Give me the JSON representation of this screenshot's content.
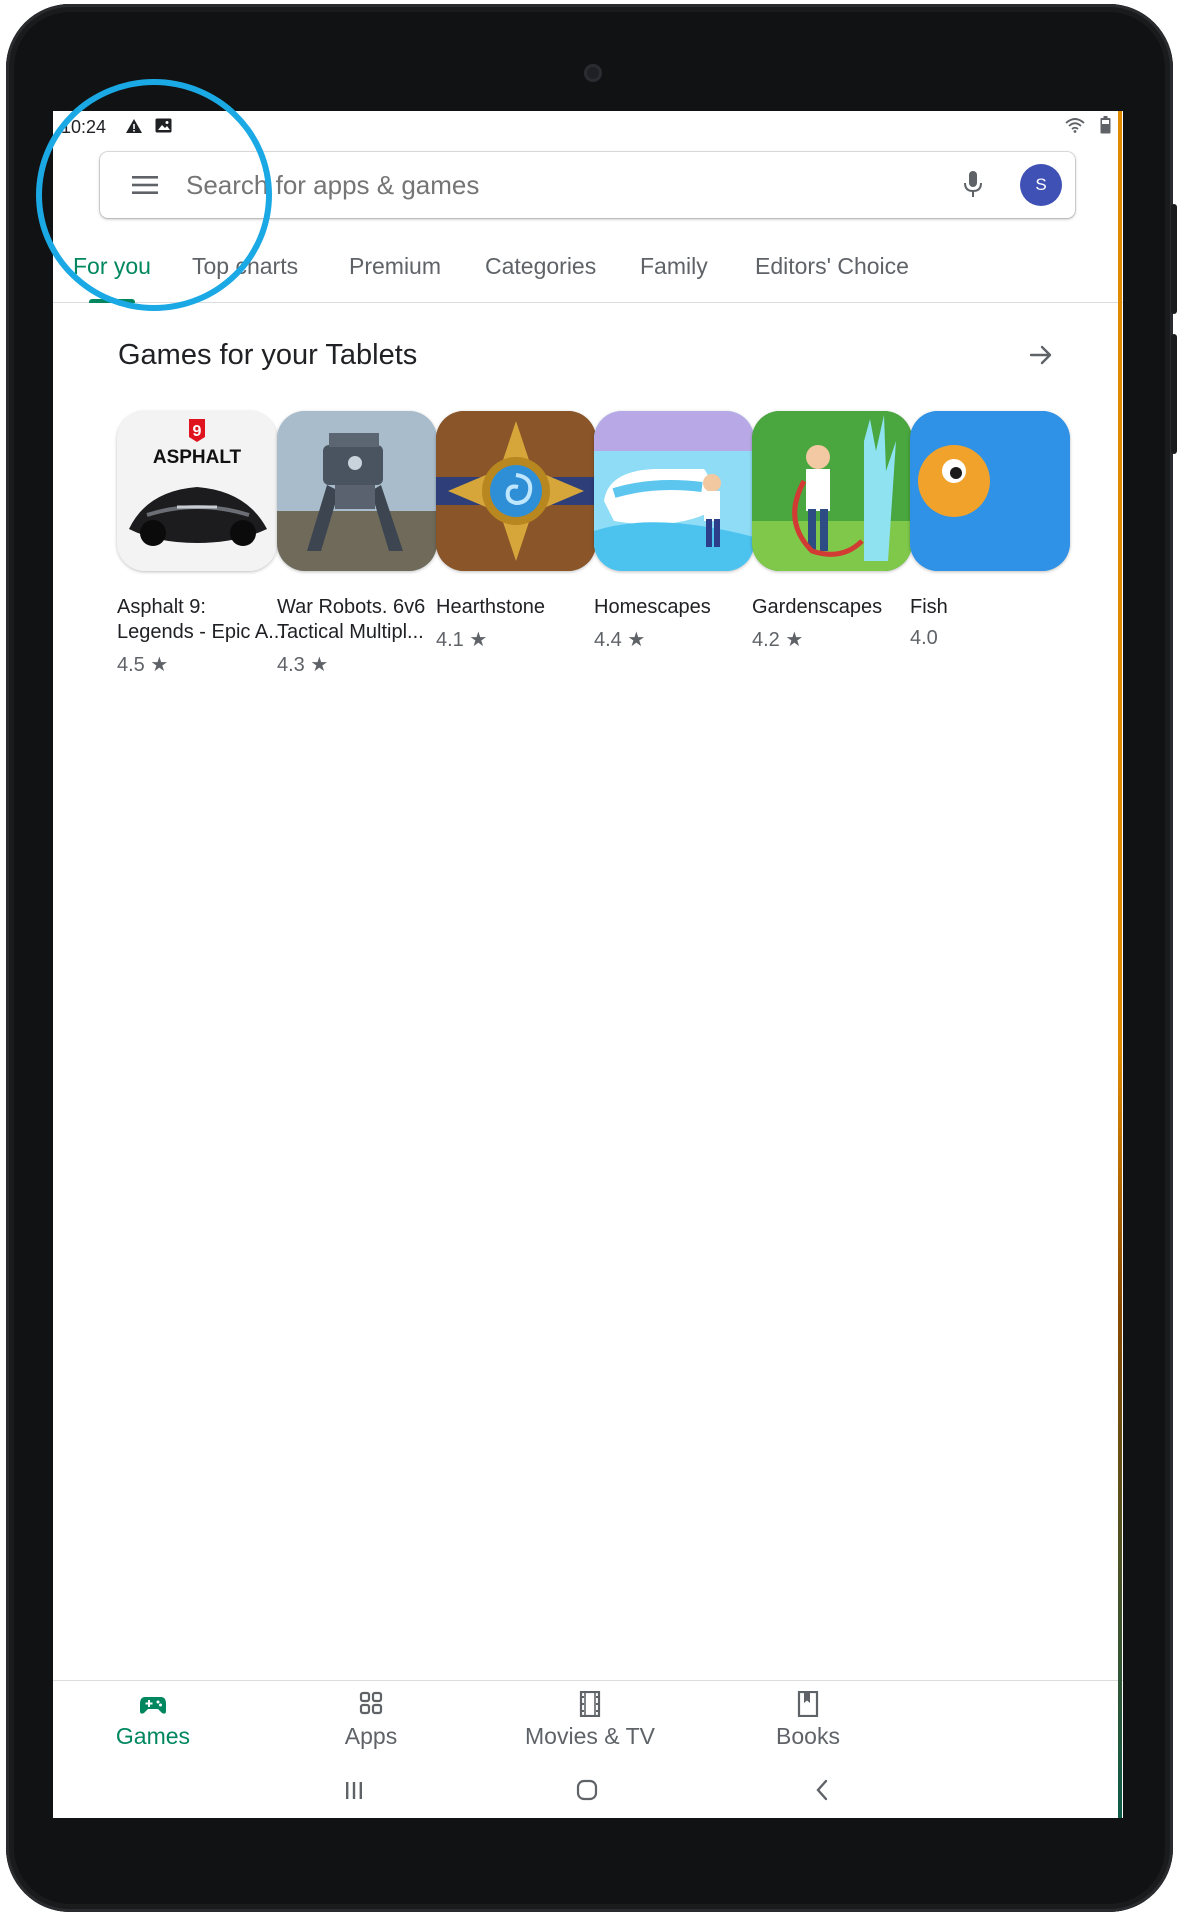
{
  "status_bar": {
    "time": "10:24"
  },
  "search": {
    "placeholder": "Search for apps & games",
    "avatar_letter": "S"
  },
  "tabs": [
    {
      "label": "For you",
      "active": true
    },
    {
      "label": "Top charts"
    },
    {
      "label": "Premium"
    },
    {
      "label": "Categories"
    },
    {
      "label": "Family"
    },
    {
      "label": "Editors' Choice"
    }
  ],
  "section": {
    "title": "Games for your Tablets"
  },
  "apps": [
    {
      "name_line1": "Asphalt 9:",
      "name_line2": "Legends - Epic A...",
      "rating": "4.5 ★",
      "icon": "asphalt-icon"
    },
    {
      "name_line1": "War Robots. 6v6",
      "name_line2": "Tactical Multipl...",
      "rating": "4.3 ★",
      "icon": "war-robots-icon"
    },
    {
      "name_line1": "Hearthstone",
      "name_line2": "",
      "rating": "4.1 ★",
      "icon": "hearthstone-icon"
    },
    {
      "name_line1": "Homescapes",
      "name_line2": "",
      "rating": "4.4 ★",
      "icon": "homescapes-icon"
    },
    {
      "name_line1": "Gardenscapes",
      "name_line2": "",
      "rating": "4.2 ★",
      "icon": "gardenscapes-icon"
    },
    {
      "name_line1": "Fish",
      "name_line2": "",
      "rating": "4.0",
      "icon": "fish-icon"
    }
  ],
  "asphalt_logo": {
    "number": "9",
    "word": "ASPHALT"
  },
  "bottom_nav": [
    {
      "label": "Games",
      "active": true,
      "icon": "gamepad-icon"
    },
    {
      "label": "Apps",
      "icon": "apps-grid-icon"
    },
    {
      "label": "Movies & TV",
      "icon": "film-icon"
    },
    {
      "label": "Books",
      "icon": "bookmark-icon"
    }
  ],
  "colors": {
    "accent_green": "#01875f",
    "highlight_ring": "#1aa9e4",
    "avatar_bg": "#3f51b5"
  }
}
